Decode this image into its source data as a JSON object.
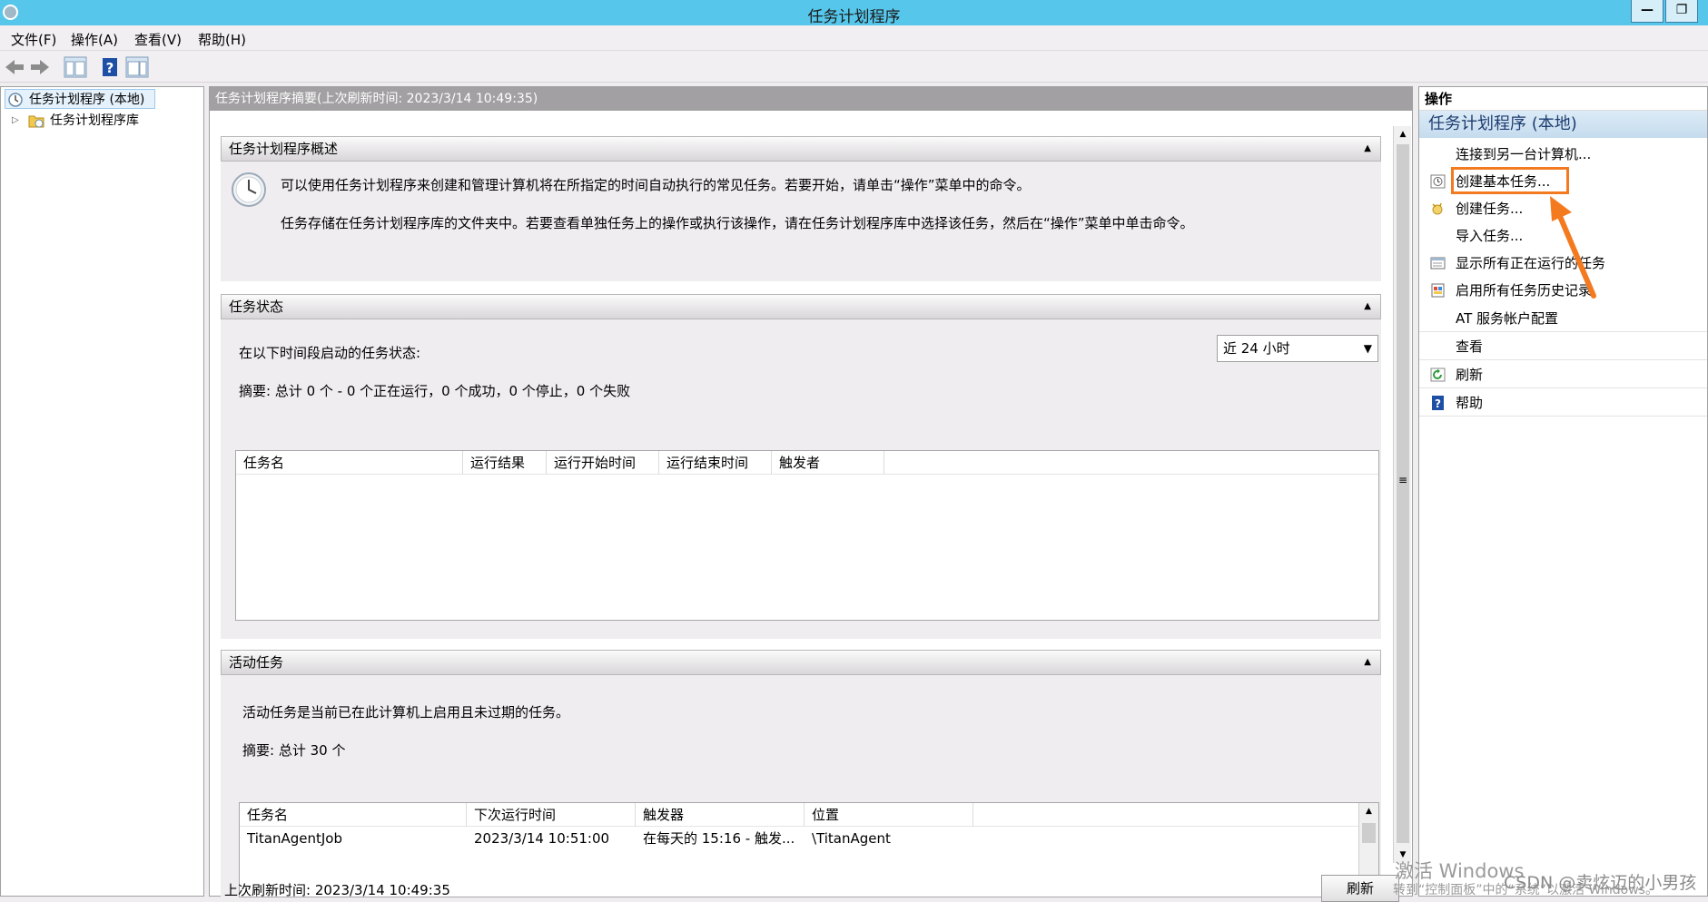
{
  "window": {
    "title": "任务计划程序",
    "minimize": "—",
    "restore": "❐"
  },
  "menu": [
    "文件(F)",
    "操作(A)",
    "查看(V)",
    "帮助(H)"
  ],
  "tree": {
    "root": "任务计划程序 (本地)",
    "library": "任务计划程序库"
  },
  "center": {
    "header": "任务计划程序摘要(上次刷新时间: 2023/3/14 10:49:35)",
    "overview": {
      "title": "任务计划程序概述",
      "line1": "可以使用任务计划程序来创建和管理计算机将在所指定的时间自动执行的常见任务。若要开始，请单击“操作”菜单中的命令。",
      "line2": "任务存储在任务计划程序库的文件夹中。若要查看单独任务上的操作或执行该操作，请在任务计划程序库中选择该任务，然后在“操作”菜单中单击命令。"
    },
    "status": {
      "title": "任务状态",
      "period_label": "在以下时间段启动的任务状态:",
      "period_value": "近 24 小时",
      "summary": "摘要: 总计 0 个 - 0 个正在运行，0 个成功，0 个停止，0 个失败",
      "columns": [
        "任务名",
        "运行结果",
        "运行开始时间",
        "运行结束时间",
        "触发者"
      ]
    },
    "active": {
      "title": "活动任务",
      "desc": "活动任务是当前已在此计算机上启用且未过期的任务。",
      "summary": "摘要: 总计 30 个",
      "columns": [
        "任务名",
        "下次运行时间",
        "触发器",
        "位置"
      ],
      "rows": [
        [
          "TitanAgentJob",
          "2023/3/14 10:51:00",
          "在每天的 15:16 - 触发...",
          "\\TitanAgent"
        ]
      ]
    },
    "footer": {
      "last_refresh": "上次刷新时间: 2023/3/14 10:49:35",
      "refresh_button": "刷新"
    }
  },
  "actions": {
    "header": "操作",
    "group": "任务计划程序 (本地)",
    "items": [
      {
        "label": "连接到另一台计算机...",
        "icon": "none"
      },
      {
        "label": "创建基本任务...",
        "icon": "basic-task-icon"
      },
      {
        "label": "创建任务...",
        "icon": "create-task-icon"
      },
      {
        "label": "导入任务...",
        "icon": "none"
      },
      {
        "label": "显示所有正在运行的任务",
        "icon": "running-tasks-icon"
      },
      {
        "label": "启用所有任务历史记录",
        "icon": "history-icon"
      },
      {
        "label": "AT 服务帐户配置",
        "icon": "none"
      },
      {
        "label": "查看",
        "icon": "none"
      },
      {
        "label": "刷新",
        "icon": "refresh-icon"
      },
      {
        "label": "帮助",
        "icon": "help-icon"
      }
    ]
  },
  "watermark": {
    "line1": "激活 Windows",
    "line2": "转到“控制面板”中的“系统”以激活 Windows。",
    "csdn": "CSDN @卖炫迈的小男孩"
  },
  "colors": {
    "titlebar": "#56c6ea",
    "highlight": "#f47a20",
    "group_text": "#1e3d70"
  }
}
